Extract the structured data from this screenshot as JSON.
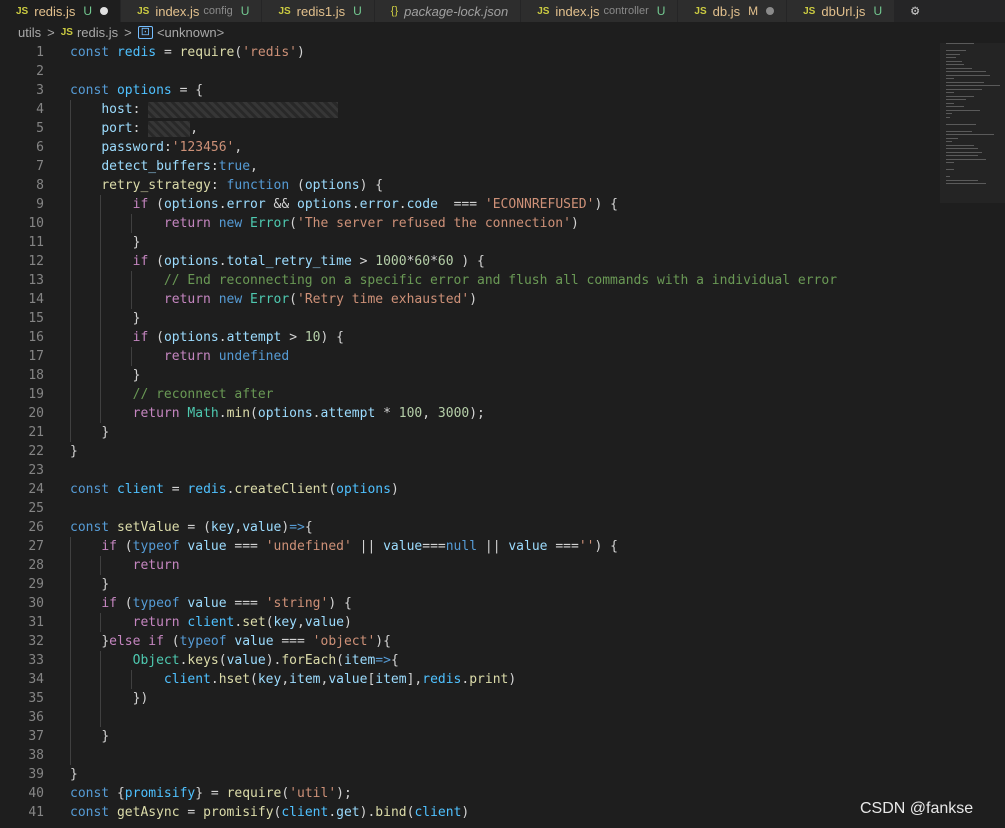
{
  "tabs": [
    {
      "icon": "JS",
      "name": "redis.js",
      "hint": "",
      "status": "U",
      "dirty": true,
      "active": true
    },
    {
      "icon": "JS",
      "name": "index.js",
      "hint": "config",
      "status": "U",
      "dirty": false,
      "active": false
    },
    {
      "icon": "JS",
      "name": "redis1.js",
      "hint": "",
      "status": "U",
      "dirty": false,
      "active": false
    },
    {
      "icon": "{}",
      "name": "package-lock.json",
      "hint": "",
      "status": "",
      "dirty": false,
      "active": false
    },
    {
      "icon": "JS",
      "name": "index.js",
      "hint": "controller",
      "status": "U",
      "dirty": false,
      "active": false
    },
    {
      "icon": "JS",
      "name": "db.js",
      "hint": "",
      "status": "M",
      "dirty": true,
      "active": false
    },
    {
      "icon": "JS",
      "name": "dbUrl.js",
      "hint": "",
      "status": "U",
      "dirty": false,
      "active": false
    }
  ],
  "breadcrumb": {
    "folder": "utils",
    "file_icon": "JS",
    "file": "redis.js",
    "symbol": "<unknown>"
  },
  "editor": {
    "line_numbers": [
      "1",
      "2",
      "3",
      "4",
      "5",
      "6",
      "7",
      "8",
      "9",
      "10",
      "11",
      "12",
      "13",
      "14",
      "15",
      "16",
      "17",
      "18",
      "19",
      "20",
      "21",
      "22",
      "23",
      "24",
      "25",
      "26",
      "27",
      "28",
      "29",
      "30",
      "31",
      "32",
      "33",
      "34",
      "35",
      "36",
      "37",
      "38",
      "39",
      "40",
      "41"
    ]
  },
  "watermark": "CSDN @fankse"
}
